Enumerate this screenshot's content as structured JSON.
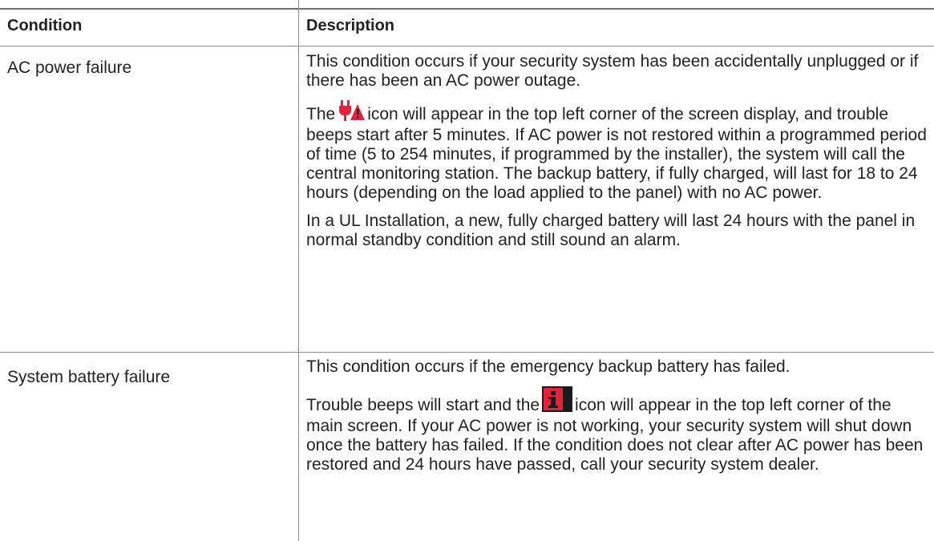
{
  "table": {
    "headers": {
      "condition": "Condition",
      "description": "Description"
    },
    "rows": [
      {
        "condition": "AC power failure",
        "p1": "This condition occurs if your security system has been accidentally unplugged or if there has been an AC power outage.",
        "p2_before": "The",
        "p2_icon": "ac-power-trouble-icon",
        "p2_after": "icon will appear in the top left corner of the screen display, and trouble beeps start after 5 minutes. If AC power is not restored within a programmed period of time (5 to 254 minutes, if programmed by the installer), the system will call the central monitoring station. The backup battery, if fully charged, will last for 18 to 24 hours (depending on the load applied to the panel) with no AC power.",
        "p3": "In a UL Installation, a new, fully charged battery will last 24 hours with the panel in normal standby condition and still sound an alarm."
      },
      {
        "condition": "System battery failure",
        "p1": "This condition occurs if the emergency backup battery has failed.",
        "p2_before": "Trouble beeps will start and the",
        "p2_icon": "system-trouble-info-icon",
        "p2_after": "icon will appear in the top left corner of the main screen. If your AC power is not working, your security system will shut down once the battery has failed. If the condition does not clear after AC power has been restored and 24 hours have passed, call your security system dealer."
      }
    ]
  },
  "colors": {
    "icon_red": "#e8213a",
    "icon_dark": "#1a1a1a",
    "rule": "#8c8c8c"
  }
}
